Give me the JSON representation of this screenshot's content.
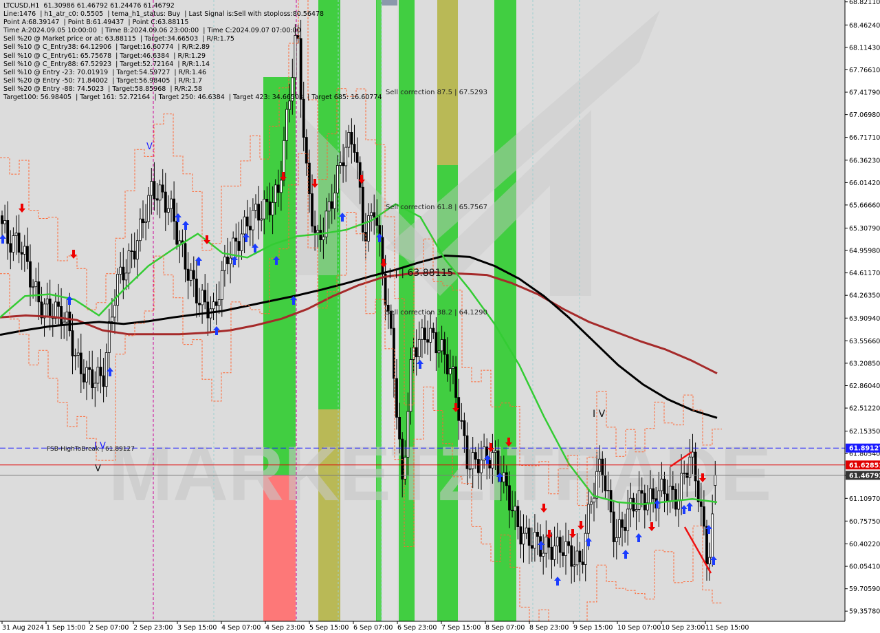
{
  "colors": {
    "background": "#ffffff",
    "plot_background": "#dcdcdc",
    "bull_candle": "#000000",
    "bear_candle": "#000000",
    "ema_fast": "#33cc33",
    "ema_slow": "#000000",
    "ema_long": "#a52a2a",
    "stop_band": "#ff6633",
    "fsb_line": "#1a1aff",
    "red_level": "#e00000",
    "current_price": "#555555",
    "zone_green": "#33cc33",
    "zone_olive": "#b5b54a",
    "zone_red": "#ff6f6f",
    "sell_arrow": "#ee0000",
    "buy_arrow": "#1b3cff",
    "watermark": "#c8c8c8"
  },
  "info_panel": [
    "LTCUSD,H1  61.30986 61.46792 61.24476 61.46792",
    "Line:1476  | h1_atr_c0: 0.5505  | tema_h1_status: Buy  | Last Signal is:Sell with stoploss:80.56478",
    "Point A:68.39147  | Point B:61.49437  | Point C:63.88115",
    "Time A:2024.09.05 10:00:00  | Time B:2024.09.06 23:00:00  | Time C:2024.09.07 07:00:00",
    "Sell %20 @ Market price or at: 63.88115  | Target:34.66503  | R/R:1.75",
    "Sell %10 @ C_Entry38: 64.12906  | Target:16.60774  | R/R:2.89",
    "Sell %10 @ C_Entry61: 65.75678  | Target:46.6384  | R/R:1.29",
    "Sell %10 @ C_Entry88: 67.52923  | Target:52.72164  | R/R:1.14",
    "Sell %10 @ Entry -23: 70.01919  | Target:54.59727  | R/R:1.46",
    "Sell %20 @ Entry -50: 71.84002  | Target:56.98405  | R/R:1.7",
    "Sell %20 @ Entry -88: 74.5023  | Target:58.85968  | R/R:2.58",
    "Target100: 56.98405  | Target 161: 52.72164  | Target 250: 46.6384  | Target 423: 34.66503  | Target 685: 16.60774"
  ],
  "annotations": {
    "sell_correction_875": "Sell correction 87.5 | 67.5293",
    "sell_correction_618": "Sell correction 61.8 | 65.7567",
    "sell_correction_382": "Sell correction 38.2 | 64.1290",
    "point_c_label": "| | | 63.88115",
    "fsb_label": "FSB-HighToBreak | 61.89127",
    "wave_iv_1": "I V",
    "wave_iv_2": "I V",
    "wave_v_top": "V",
    "wave_v_low": "V",
    "watermark": "MARKETZITRADE"
  },
  "price_tags": {
    "fsb": "61.89127",
    "red_level": "61.62851",
    "current": "61.46792"
  },
  "chart_data": {
    "type": "candlestick",
    "symbol": "LTCUSD",
    "timeframe": "H1",
    "ylim": [
      59.2,
      68.85
    ],
    "y_ticks": [
      68.8211,
      68.4624,
      68.1143,
      67.7661,
      67.4179,
      67.0698,
      66.7171,
      66.3623,
      66.0142,
      65.6666,
      65.3079,
      64.9598,
      64.6117,
      64.2635,
      63.9094,
      63.5566,
      63.2085,
      62.8604,
      62.5122,
      62.1535,
      61.8054,
      61.4679,
      61.1097,
      60.7575,
      60.4022,
      60.0541,
      59.7059,
      59.3578
    ],
    "x_labels": [
      "31 Aug 2024",
      "1 Sep 15:00",
      "2 Sep 07:00",
      "2 Sep 23:00",
      "3 Sep 15:00",
      "4 Sep 07:00",
      "4 Sep 23:00",
      "5 Sep 15:00",
      "6 Sep 07:00",
      "6 Sep 23:00",
      "7 Sep 15:00",
      "8 Sep 07:00",
      "8 Sep 23:00",
      "9 Sep 15:00",
      "10 Sep 07:00",
      "10 Sep 23:00",
      "11 Sep 15:00"
    ],
    "levels": {
      "fsb_high_to_break": 61.89127,
      "red_level": 61.62851,
      "current_price": 61.46792
    },
    "last_candle": {
      "open": 61.30986,
      "high": 61.46792,
      "low": 61.24476,
      "close": 61.46792
    },
    "ema_slow": [
      63.65,
      63.72,
      63.78,
      63.82,
      63.85,
      63.82,
      63.86,
      63.92,
      63.97,
      64.02,
      64.1,
      64.18,
      64.26,
      64.35,
      64.45,
      64.56,
      64.66,
      64.78,
      64.88,
      64.86,
      64.72,
      64.52,
      64.25,
      63.92,
      63.55,
      63.18,
      62.88,
      62.65,
      62.48,
      62.36
    ],
    "ema_long": [
      63.92,
      63.95,
      63.93,
      63.88,
      63.72,
      63.66,
      63.66,
      63.66,
      63.68,
      63.72,
      63.8,
      63.9,
      64.05,
      64.25,
      64.42,
      64.55,
      64.6,
      64.62,
      64.6,
      64.58,
      64.45,
      64.28,
      64.05,
      63.85,
      63.7,
      63.55,
      63.42,
      63.25,
      63.05
    ],
    "ema_fast": [
      63.92,
      64.25,
      64.28,
      64.2,
      63.95,
      64.35,
      64.72,
      64.98,
      65.22,
      64.92,
      64.85,
      65.05,
      65.18,
      65.22,
      65.28,
      65.42,
      65.68,
      65.48,
      64.82,
      64.35,
      63.82,
      63.18,
      62.38,
      61.65,
      61.15,
      61.05,
      61.02,
      61.06,
      61.1,
      61.05
    ]
  }
}
